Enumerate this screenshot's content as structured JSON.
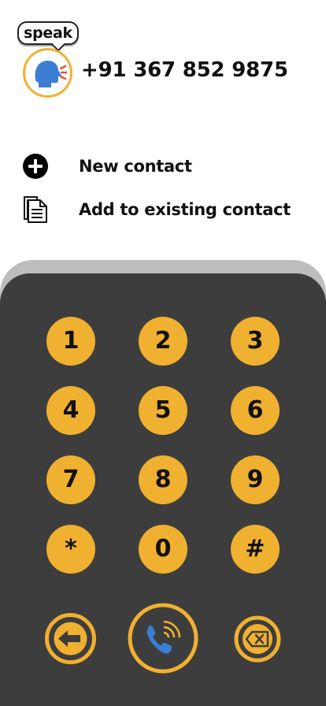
{
  "header": {
    "speak_label": "speak",
    "phone_number": "+91 367 852 9875"
  },
  "actions": [
    {
      "label": "New contact",
      "icon": "plus-circle-icon"
    },
    {
      "label": "Add to existing contact",
      "icon": "document-icon"
    }
  ],
  "keypad": {
    "keys": [
      "1",
      "2",
      "3",
      "4",
      "5",
      "6",
      "7",
      "8",
      "9",
      "*",
      "0",
      "#"
    ],
    "controls": {
      "back": "arrow-left-icon",
      "call": "phone-call-icon",
      "delete": "backspace-icon"
    }
  },
  "colors": {
    "accent": "#f0b030",
    "panel": "#3d3d3d",
    "panel_edge": "#bdbdbd",
    "call_icon": "#3a7fd4"
  }
}
